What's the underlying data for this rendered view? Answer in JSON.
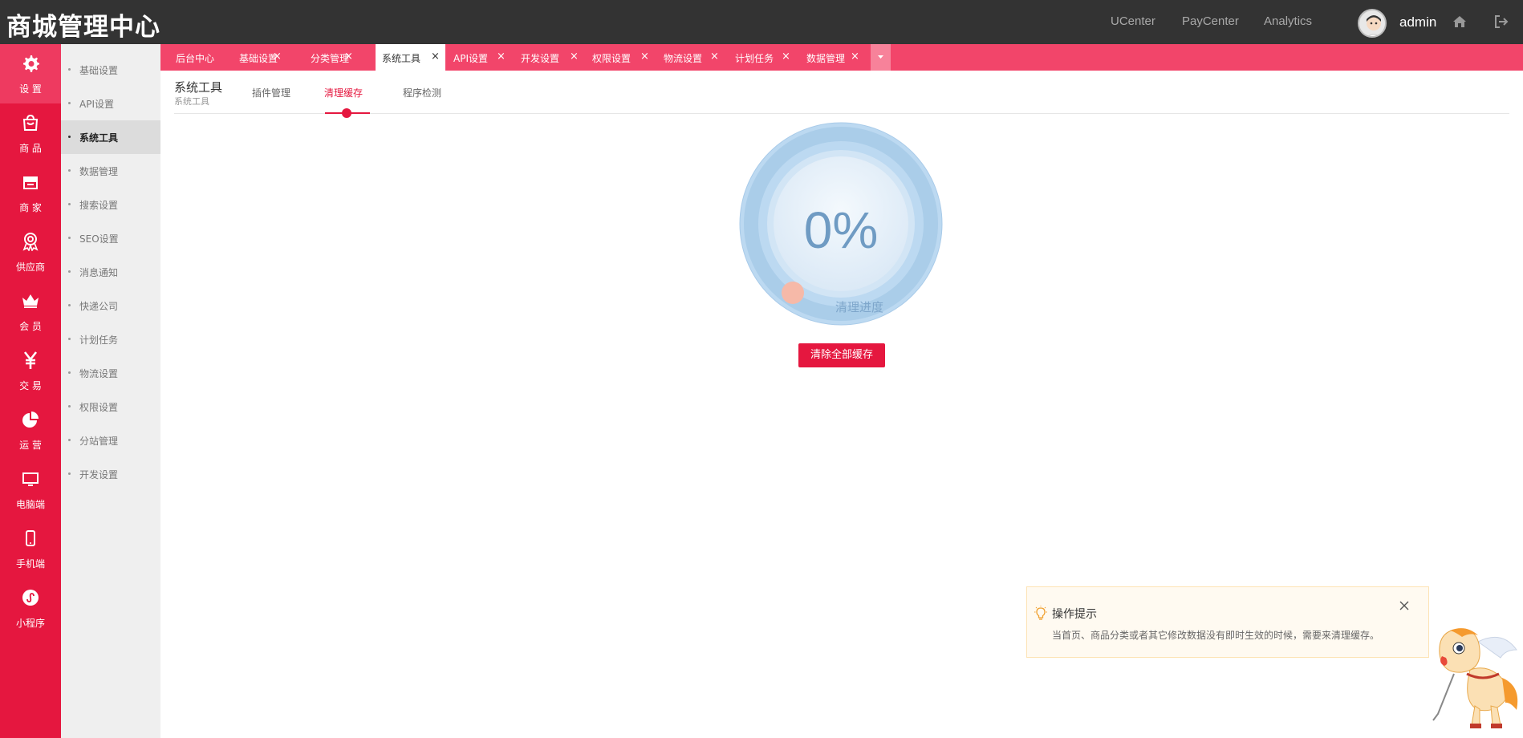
{
  "header": {
    "logo": "商城管理中心",
    "links": [
      "UCenter",
      "PayCenter",
      "Analytics"
    ],
    "username": "admin",
    "home_icon": "home-icon",
    "logout_icon": "logout-icon"
  },
  "nav": {
    "items": [
      {
        "label": "设 置",
        "icon": "gear-icon"
      },
      {
        "label": "商 品",
        "icon": "bag-icon"
      },
      {
        "label": "商 家",
        "icon": "store-icon"
      },
      {
        "label": "供应商",
        "icon": "badge-icon"
      },
      {
        "label": "会 员",
        "icon": "crown-icon"
      },
      {
        "label": "交 易",
        "icon": "yen-icon"
      },
      {
        "label": "运 营",
        "icon": "pie-icon"
      },
      {
        "label": "电脑端",
        "icon": "monitor-icon"
      },
      {
        "label": "手机端",
        "icon": "phone-icon"
      },
      {
        "label": "小程序",
        "icon": "mini-program-icon"
      }
    ],
    "active_index": 0
  },
  "subnav": {
    "items": [
      "基础设置",
      "API设置",
      "系统工具",
      "数据管理",
      "搜索设置",
      "SEO设置",
      "消息通知",
      "快递公司",
      "计划任务",
      "物流设置",
      "权限设置",
      "分站管理",
      "开发设置"
    ],
    "active_index": 2
  },
  "tabs": {
    "items": [
      "后台中心",
      "基础设置",
      "分类管理",
      "系统工具",
      "API设置",
      "开发设置",
      "权限设置",
      "物流设置",
      "计划任务",
      "数据管理"
    ],
    "active_index": 3,
    "close_glyph": "×"
  },
  "page": {
    "title": "系统工具",
    "subtitle": "系统工具",
    "subtabs": [
      "插件管理",
      "清理缓存",
      "程序检测"
    ],
    "active_subtab": 1
  },
  "gauge": {
    "value": "0%",
    "progress": 0,
    "label": "清理进度"
  },
  "action": {
    "clear_button": "清除全部缓存"
  },
  "tip": {
    "title": "操作提示",
    "text": "当首页、商品分类或者其它修改数据没有即时生效的时候，需要来清理缓存。",
    "icon": "lightbulb-icon",
    "close_icon": "close-icon"
  },
  "colors": {
    "brand_red": "#e5173f",
    "tab_bar": "#f2456a",
    "header_bg": "#333333",
    "gauge_blue": "#6f9bc3"
  }
}
